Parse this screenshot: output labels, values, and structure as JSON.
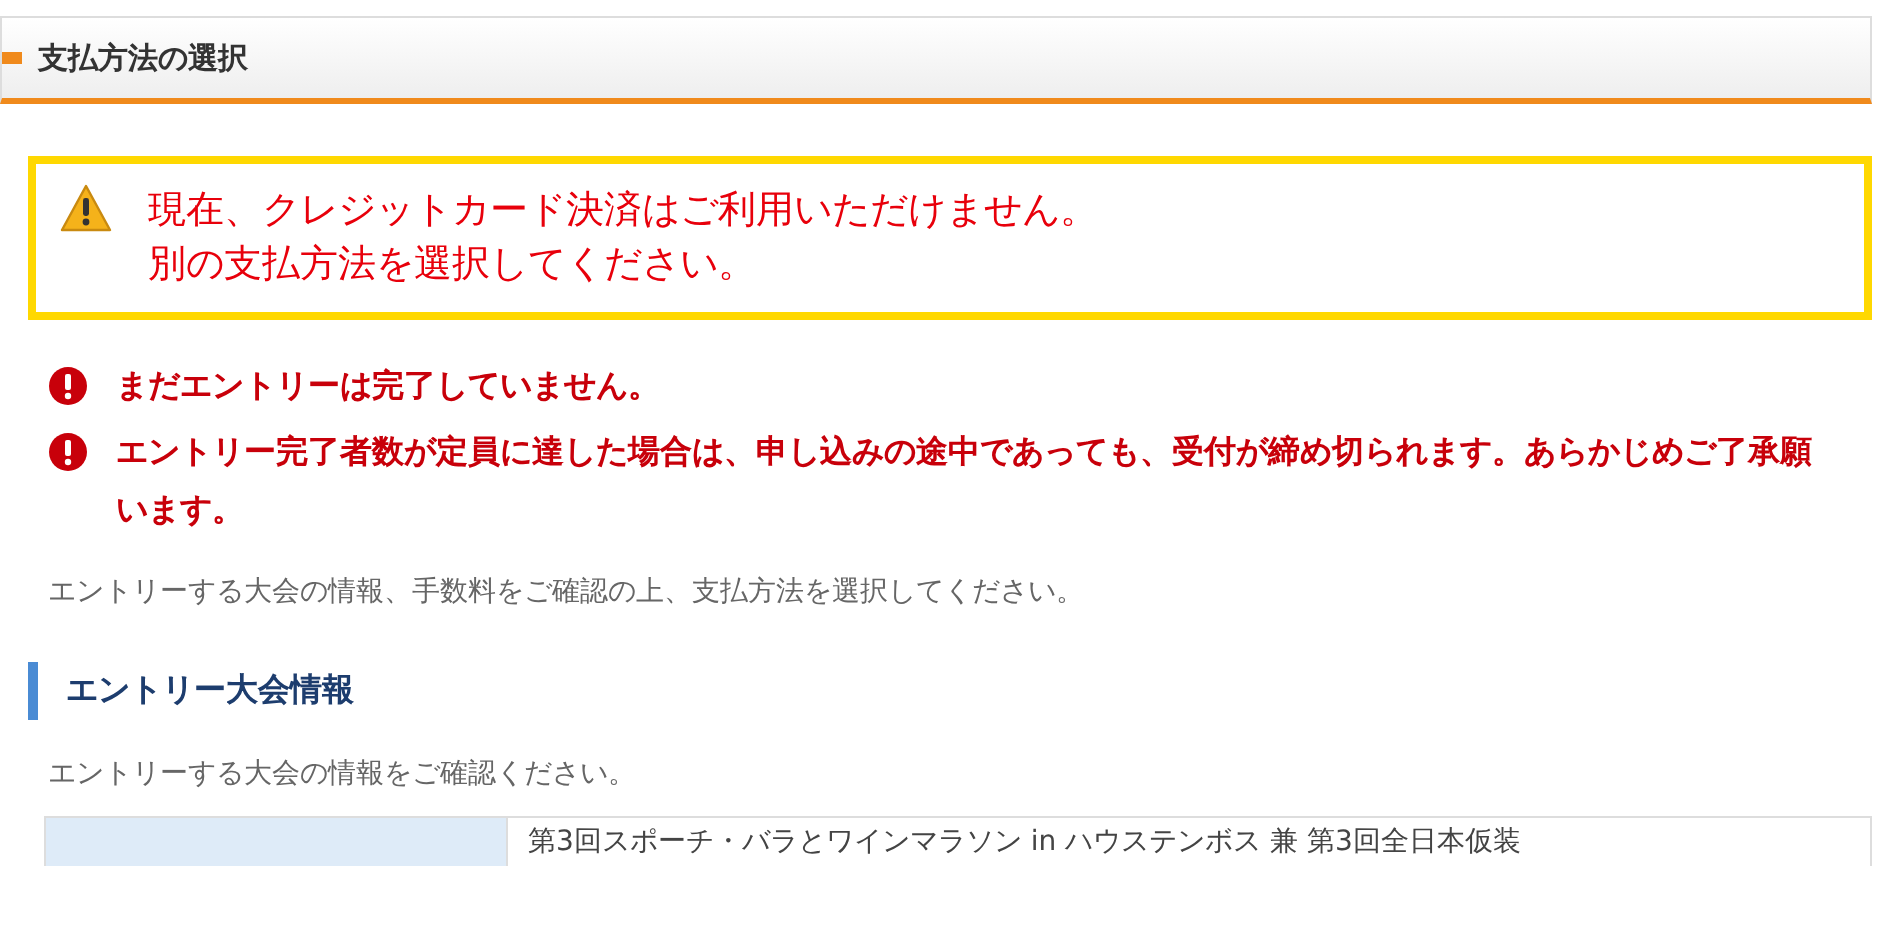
{
  "section_header": {
    "title": "支払方法の選択"
  },
  "warning": {
    "lines": [
      "現在、クレジットカード決済はご利用いただけません。",
      "別の支払方法を選択してください。"
    ]
  },
  "errors": [
    "まだエントリーは完了していません。",
    "エントリー完了者数が定員に達した場合は、申し込みの途中であっても、受付が締め切られます。あらかじめご了承願います。"
  ],
  "intro": "エントリーする大会の情報、手数料をご確認の上、支払方法を選択してください。",
  "entry_info": {
    "heading": "エントリー大会情報",
    "description": "エントリーする大会の情報をご確認ください。",
    "rows": [
      {
        "value": "第3回スポーチ・バラとワインマラソン in ハウステンボス 兼 第3回全日本仮装"
      }
    ]
  }
}
